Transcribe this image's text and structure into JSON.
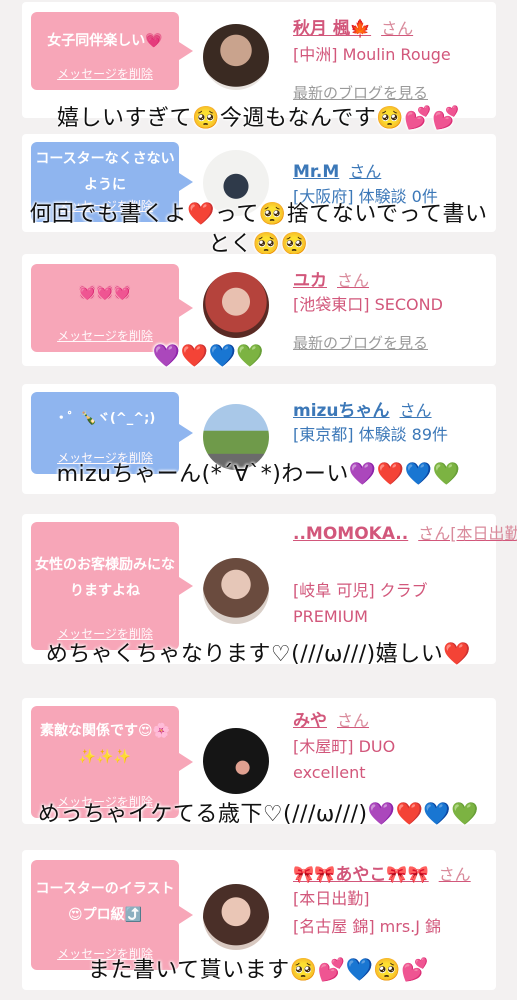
{
  "cards": [
    {
      "bubble_text": "女子同伴楽しい💗",
      "delete_label": "メッセージを削除",
      "name": "秋月 楓🍁",
      "san": "さん",
      "shop": "[中洲] Moulin Rouge",
      "blog": "最新のブログを見る",
      "overlay": "嬉しいすぎて🥺今週もなんです🥺💕💕"
    },
    {
      "bubble_text": "コースターなくさないように",
      "delete_label": "メッセージを削除",
      "name": "Mr.M",
      "san": "さん",
      "shop": "[大阪府] 体験談 0件",
      "overlay1": "何回でも書くよ❤️って🥺捨てないでって書い",
      "overlay2": "とく🥺🥺"
    },
    {
      "bubble_text": "💓💓💓",
      "delete_label": "メッセージを削除",
      "name": "ユカ",
      "san": "さん",
      "shop": "[池袋東口] SECOND",
      "blog": "最新のブログを見る",
      "overlay": "💜❤️💙💚"
    },
    {
      "bubble_text": "・゜🍾ヾ(^_^;)",
      "delete_label": "メッセージを削除",
      "name": "mizuちゃん",
      "san": "さん",
      "shop": "[東京都] 体験談 89件",
      "overlay": "mizuちゃーん(*´∀`*)わーい💜❤️💙💚"
    },
    {
      "bubble_text": "女性のお客様励みになりますよね",
      "delete_label": "メッセージを削除",
      "name": "..MOMOKA..",
      "san": "さん[本日出勤]",
      "shop1": "[岐阜 可児] クラブ",
      "shop2": "PREMIUM",
      "overlay": "めちゃくちゃなります♡(///ω///)嬉しい❤️"
    },
    {
      "bubble_text": "素敵な関係です😍🌸✨✨✨",
      "delete_label": "メッセージを削除",
      "name": "みや",
      "san": "さん",
      "shop1": "[木屋町] DUO",
      "shop2": "excellent",
      "overlay": "めっちゃイケてる歳下♡(///ω///)💜❤️💙💚"
    },
    {
      "bubble_text": "コースターのイラスト😍プロ級⤴️",
      "delete_label": "メッセージを削除",
      "name": "🎀🎀あやこ🎀🎀",
      "san": "さん",
      "shop1": "[本日出勤]",
      "shop2": "[名古屋 錦] mrs.J 錦",
      "overlay": "また書いて貰います🥺💕💙🥺💕"
    }
  ],
  "colors": {
    "pink_bubble": "#f7a6b8",
    "blue_bubble": "#8fb5ef",
    "pink_text": "#d2577b",
    "blue_text": "#3c78b8"
  }
}
